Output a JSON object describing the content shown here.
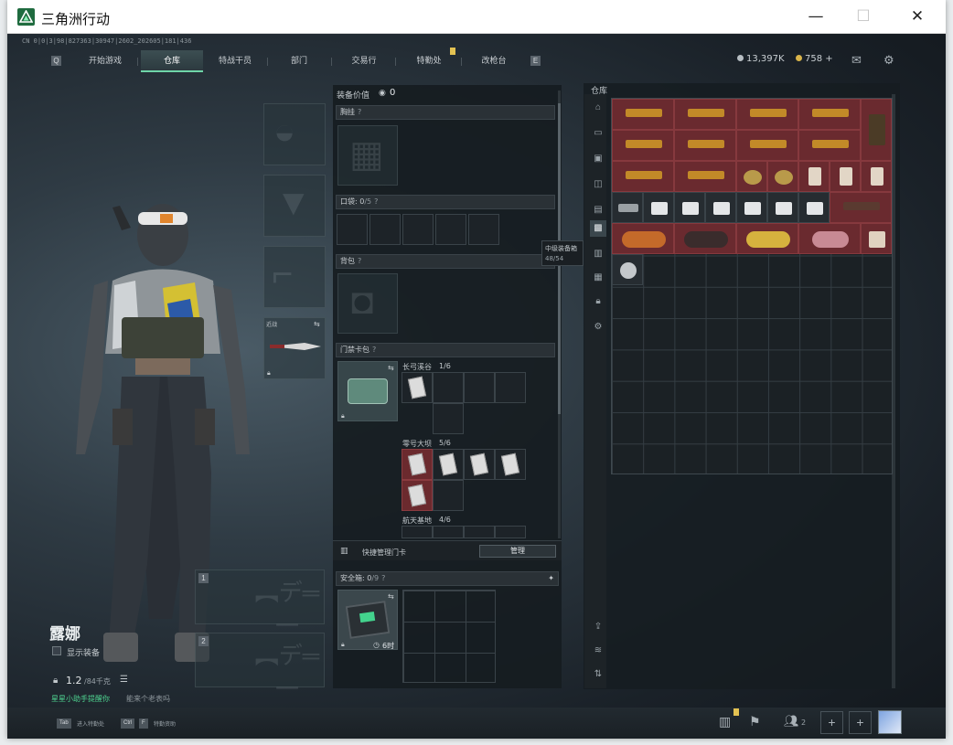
{
  "window": {
    "title": "三角洲行动",
    "minimize": "—",
    "maximize": "☐",
    "close": "✕"
  },
  "id_line": "CN 0|0|3|98|827363|30947|2602_202605|181|436",
  "nav": {
    "key_left": "Q",
    "key_right": "E",
    "tabs": [
      {
        "label": "开始游戏"
      },
      {
        "label": "仓库",
        "active": true
      },
      {
        "label": "特战干员"
      },
      {
        "label": "部门"
      },
      {
        "label": "交易行"
      },
      {
        "label": "特勤处"
      },
      {
        "label": "改枪台"
      }
    ]
  },
  "currency": {
    "hafcoin": "13,397K",
    "coupon": "758",
    "coupon_add": "+"
  },
  "character": {
    "name": "露娜",
    "show_equipment": "显示装备",
    "weight": "1.2",
    "weight_max": "/84千克",
    "tip_green": "星星小助手提醒你",
    "tip_rest": "能来个老表吗"
  },
  "weapon_slots": [
    {
      "label": "1"
    },
    {
      "label": "2"
    }
  ],
  "melee_label": "近战",
  "equipment": {
    "value_label": "装备价值",
    "value": "0",
    "chest_rig": "胸挂",
    "pockets": "口袋:",
    "pockets_count": "0",
    "pockets_unit": "/5",
    "backpack": "背包",
    "key_case": "门禁卡包",
    "maps": [
      {
        "name": "长弓溪谷",
        "count": "1/6"
      },
      {
        "name": "零号大坝",
        "count": "5/6"
      },
      {
        "name": "航天基地",
        "count": "4/6"
      }
    ],
    "quick_manage": "快捷管理门卡",
    "manage_button": "管理",
    "safebox": "安全箱:",
    "safebox_count": "0",
    "safebox_unit": "/9",
    "safebox_timer": "6时",
    "tooltip_title": "中级装备箱",
    "tooltip_count": "48/54"
  },
  "stash": {
    "title": "仓库"
  },
  "bottom": {
    "tab_key": "Tab",
    "tab_text": "进入特勤处",
    "ctrl_key": "Ctrl",
    "ctrl_key2": "F",
    "ctrl_text": "特勤资助",
    "friends_count": "2"
  }
}
